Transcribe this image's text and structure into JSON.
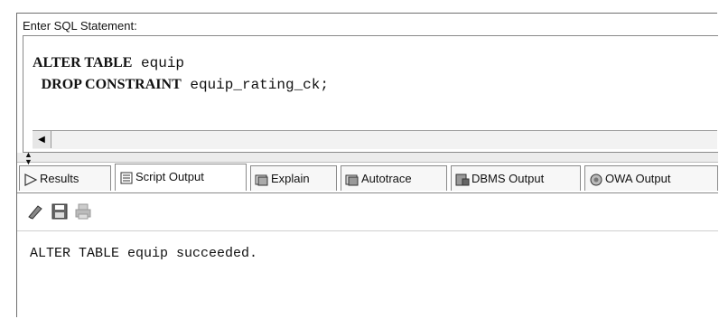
{
  "sql_label": "Enter SQL Statement:",
  "editor": {
    "line1_kw": "ALTER TABLE",
    "line1_rest": " equip",
    "line2_kw": "DROP CONSTRAINT",
    "line2_rest": " equip_rating_ck;"
  },
  "tabs": [
    {
      "label": "Results",
      "icon": "play-arrow-icon"
    },
    {
      "label": "Script Output",
      "icon": "script-output-icon"
    },
    {
      "label": "Explain",
      "icon": "explain-icon"
    },
    {
      "label": "Autotrace",
      "icon": "autotrace-icon"
    },
    {
      "label": "DBMS Output",
      "icon": "dbms-output-icon"
    },
    {
      "label": "OWA Output",
      "icon": "owa-output-icon"
    }
  ],
  "toolbar": {
    "clear_icon": "eraser-icon",
    "save_icon": "save-icon",
    "print_icon": "print-icon"
  },
  "output_text": "ALTER TABLE equip succeeded."
}
